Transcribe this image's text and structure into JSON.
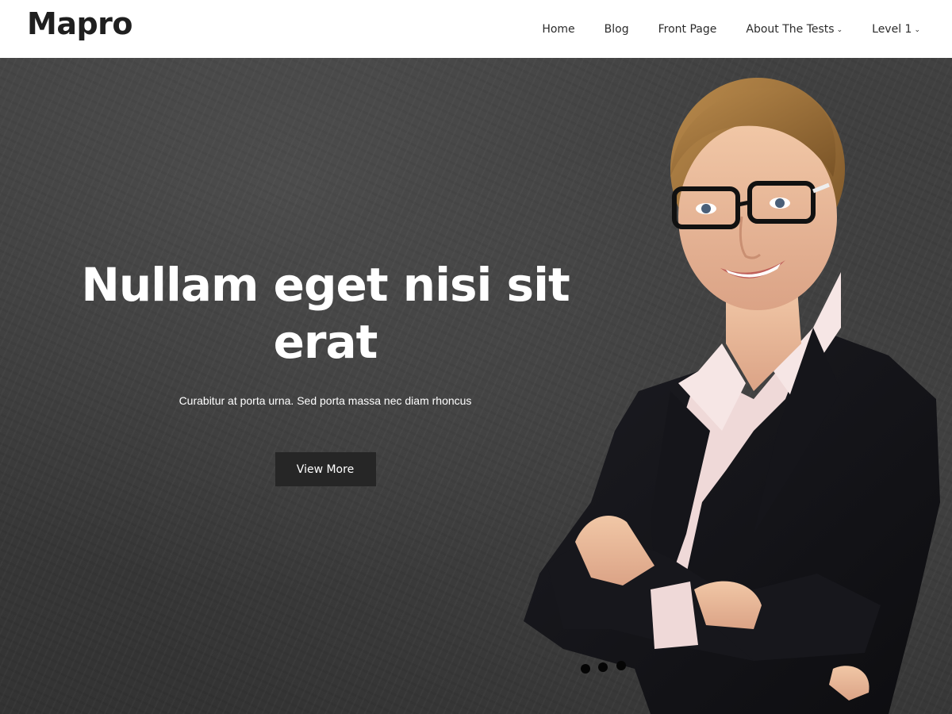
{
  "header": {
    "logo": "Mapro",
    "nav": [
      {
        "label": "Home",
        "has_dropdown": false
      },
      {
        "label": "Blog",
        "has_dropdown": false
      },
      {
        "label": "Front Page",
        "has_dropdown": false
      },
      {
        "label": "About The Tests",
        "has_dropdown": true
      },
      {
        "label": "Level 1",
        "has_dropdown": true
      }
    ],
    "dropdown_icon": "chevron-down-icon"
  },
  "hero": {
    "title_line1": "Nullam eget nisi sit",
    "title_line2": "erat",
    "subtitle": "Curabitur at porta urna. Sed porta massa nec diam rhoncus",
    "button_label": "View More",
    "image": "woman-in-suit-photo"
  },
  "colors": {
    "header_bg": "#ffffff",
    "hero_bg": "#3b3b3b",
    "button_bg": "#262626",
    "text_dark": "#1f1f1f",
    "text_light": "#ffffff"
  }
}
